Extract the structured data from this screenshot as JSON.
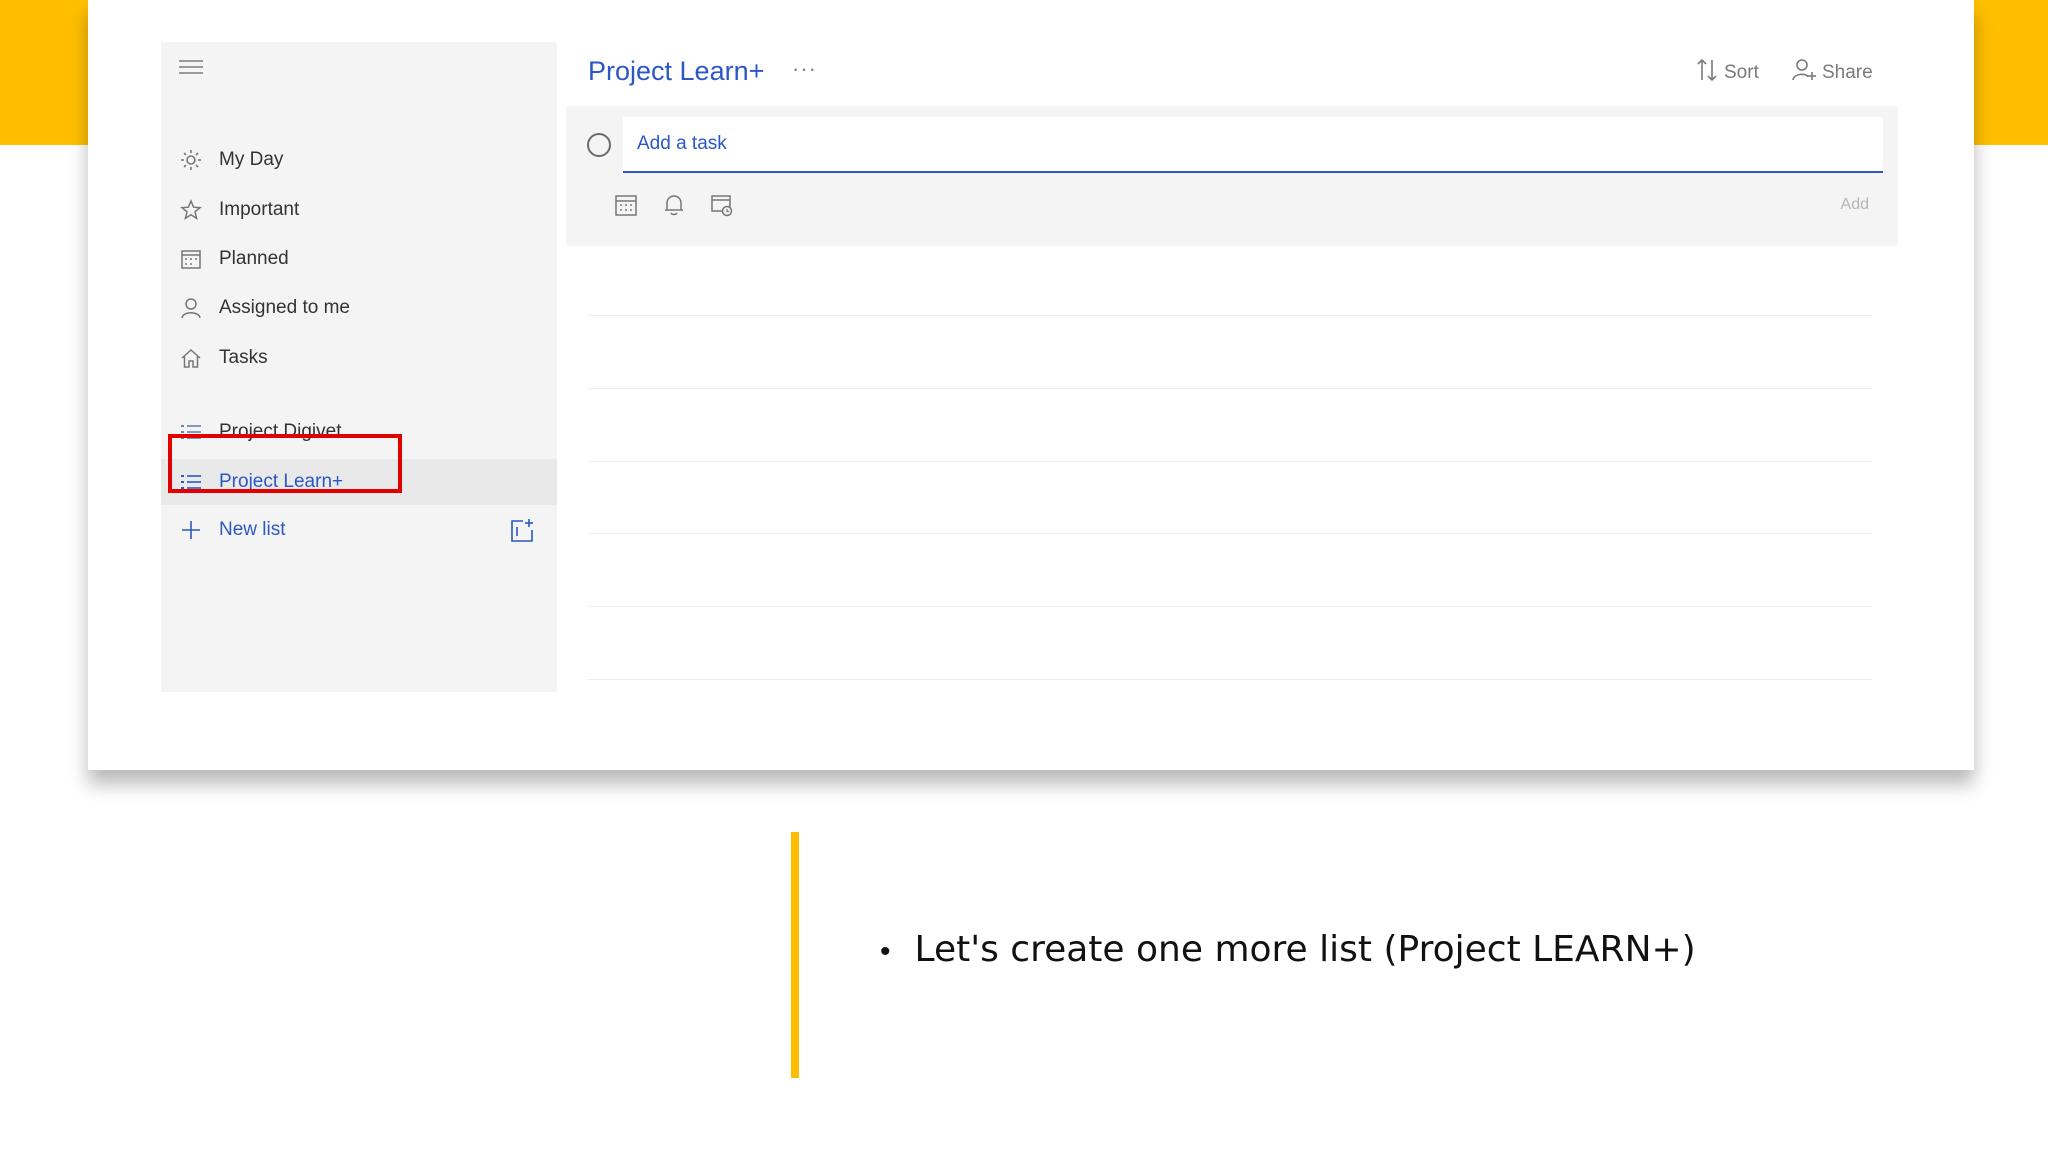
{
  "sidebar": {
    "items": [
      {
        "label": "My Day",
        "icon": "sun-icon"
      },
      {
        "label": "Important",
        "icon": "star-icon"
      },
      {
        "label": "Planned",
        "icon": "calendar-icon"
      },
      {
        "label": "Assigned to me",
        "icon": "person-icon"
      },
      {
        "label": "Tasks",
        "icon": "home-icon"
      }
    ],
    "lists": [
      {
        "label": "Project Digivet",
        "icon": "list-icon"
      },
      {
        "label": "Project Learn+",
        "icon": "list-icon",
        "selected": true
      }
    ],
    "new_list_label": "New list"
  },
  "main": {
    "title": "Project Learn+",
    "more": "···",
    "sort_label": "Sort",
    "share_label": "Share",
    "add_task_placeholder": "Add a task",
    "add_button_label": "Add"
  },
  "slide": {
    "bullet": "Let's create one more list (Project LEARN+)"
  },
  "colors": {
    "accent_yellow": "#ffbf00",
    "brand_blue": "#2b58c4",
    "highlight_red": "#e00000"
  }
}
